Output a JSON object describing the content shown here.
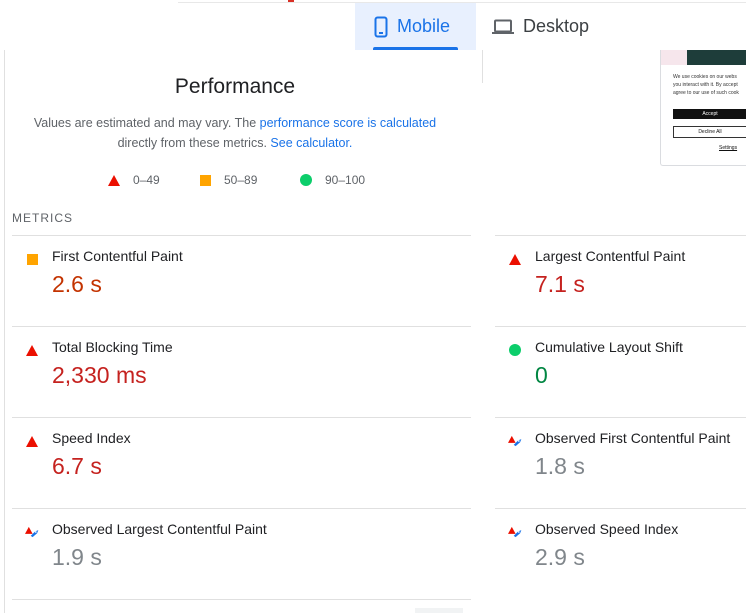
{
  "tabs": {
    "mobile": {
      "label": "Mobile",
      "icon": "smartphone-icon",
      "selected": true
    },
    "desktop": {
      "label": "Desktop",
      "icon": "laptop-icon",
      "selected": false
    }
  },
  "performance": {
    "title": "Performance",
    "desc_prefix": "Values are estimated and may vary. The ",
    "desc_link1": "performance score is calculated",
    "desc_middle": "directly from these metrics. ",
    "desc_link2": "See calculator."
  },
  "legend": [
    {
      "range": "0–49",
      "icon": "red-triangle-icon"
    },
    {
      "range": "50–89",
      "icon": "orange-square-icon"
    },
    {
      "range": "90–100",
      "icon": "green-circle-icon"
    }
  ],
  "thumbnail": {
    "text_lines": [
      "We use cookies on our webs",
      "you interact with it. By accept",
      "agree to our use of such cook"
    ],
    "accept": "Accept",
    "decline": "Decline All",
    "settings": "Settings"
  },
  "metrics_label": "METRICS",
  "metrics": [
    {
      "title": "First Contentful Paint",
      "value": "2.6 s",
      "rating": "average",
      "icon": "orange-square-icon"
    },
    {
      "title": "Largest Contentful Paint",
      "value": "7.1 s",
      "rating": "poor",
      "icon": "red-triangle-icon"
    },
    {
      "title": "Total Blocking Time",
      "value": "2,330 ms",
      "rating": "poor",
      "icon": "red-triangle-icon"
    },
    {
      "title": "Cumulative Layout Shift",
      "value": "0",
      "rating": "good",
      "icon": "green-circle-icon"
    },
    {
      "title": "Speed Index",
      "value": "6.7 s",
      "rating": "poor",
      "icon": "red-triangle-icon"
    },
    {
      "title": "Observed First Contentful Paint",
      "value": "1.8 s",
      "rating": "observed",
      "icon": "observed-rocket-icon"
    },
    {
      "title": "Observed Largest Contentful Paint",
      "value": "1.9 s",
      "rating": "observed",
      "icon": "observed-rocket-icon"
    },
    {
      "title": "Observed Speed Index",
      "value": "2.9 s",
      "rating": "observed",
      "icon": "observed-rocket-icon"
    }
  ],
  "colors": {
    "accent": "#1a73e8",
    "poor": "#c5221f",
    "average": "#c33300",
    "good": "#018642",
    "observed": "#80868b"
  }
}
